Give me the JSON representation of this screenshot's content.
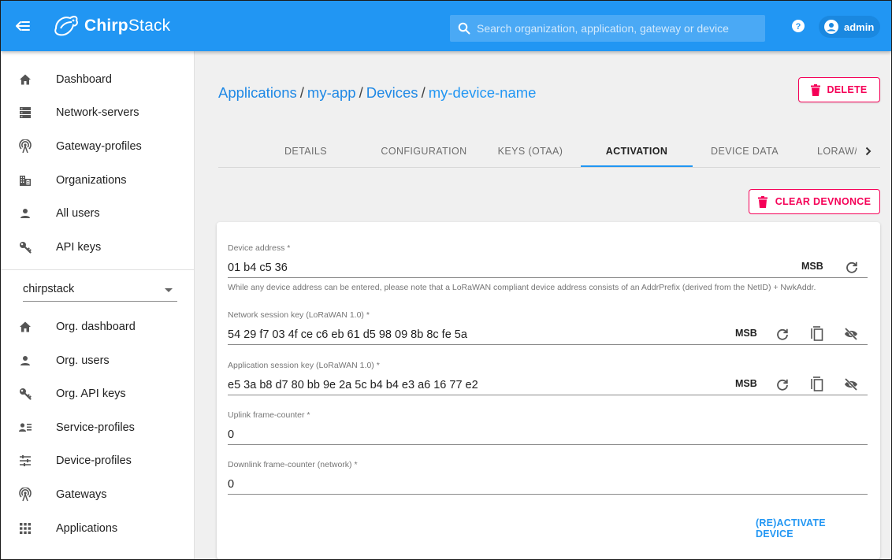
{
  "header": {
    "brand_bold": "Chirp",
    "brand_rest": "Stack",
    "search_placeholder": "Search organization, application, gateway or device",
    "user_label": "admin"
  },
  "sidebar": {
    "admin_items": [
      {
        "label": "Dashboard",
        "icon": "home-icon"
      },
      {
        "label": "Network-servers",
        "icon": "server-icon"
      },
      {
        "label": "Gateway-profiles",
        "icon": "antenna-icon"
      },
      {
        "label": "Organizations",
        "icon": "domain-icon"
      },
      {
        "label": "All users",
        "icon": "user-icon"
      },
      {
        "label": "API keys",
        "icon": "key-icon"
      }
    ],
    "org_select_value": "chirpstack",
    "org_items": [
      {
        "label": "Org. dashboard",
        "icon": "home-icon"
      },
      {
        "label": "Org. users",
        "icon": "user-icon"
      },
      {
        "label": "Org. API keys",
        "icon": "key-icon"
      },
      {
        "label": "Service-profiles",
        "icon": "account-details-icon"
      },
      {
        "label": "Device-profiles",
        "icon": "tune-icon"
      },
      {
        "label": "Gateways",
        "icon": "antenna-icon"
      },
      {
        "label": "Applications",
        "icon": "apps-icon"
      }
    ]
  },
  "breadcrumb": {
    "applications": "Applications",
    "app": "my-app",
    "devices": "Devices",
    "device": "my-device-name",
    "separator": "/"
  },
  "actions": {
    "delete_label": "DELETE",
    "clear_devnonce_label": "CLEAR DEVNONCE",
    "activate_label": "(RE)ACTIVATE DEVICE"
  },
  "tabs": [
    {
      "label": "DETAILS",
      "active": false
    },
    {
      "label": "CONFIGURATION",
      "active": false
    },
    {
      "label": "KEYS (OTAA)",
      "active": false
    },
    {
      "label": "ACTIVATION",
      "active": true
    },
    {
      "label": "DEVICE DATA",
      "active": false
    },
    {
      "label": "LORAW/",
      "active": false
    }
  ],
  "form": {
    "device_address": {
      "label": "Device address *",
      "value": "01 b4 c5 36",
      "byte_order": "MSB",
      "help": "While any device address can be entered, please note that a LoRaWAN compliant device address consists of an AddrPrefix (derived from the NetID) + NwkAddr."
    },
    "nwk_s_key": {
      "label": "Network session key (LoRaWAN 1.0) *",
      "value": "54 29 f7 03 4f ce c6 eb 61 d5 98 09 8b 8c fe 5a",
      "byte_order": "MSB"
    },
    "app_s_key": {
      "label": "Application session key (LoRaWAN 1.0) *",
      "value": "e5 3a b8 d7 80 bb 9e 2a 5c b4 b4 e3 a6 16 77 e2",
      "byte_order": "MSB"
    },
    "f_cnt_up": {
      "label": "Uplink frame-counter *",
      "value": "0"
    },
    "n_f_cnt_down": {
      "label": "Downlink frame-counter (network) *",
      "value": "0"
    }
  },
  "colors": {
    "primary": "#2196f3",
    "danger": "#f50057"
  }
}
